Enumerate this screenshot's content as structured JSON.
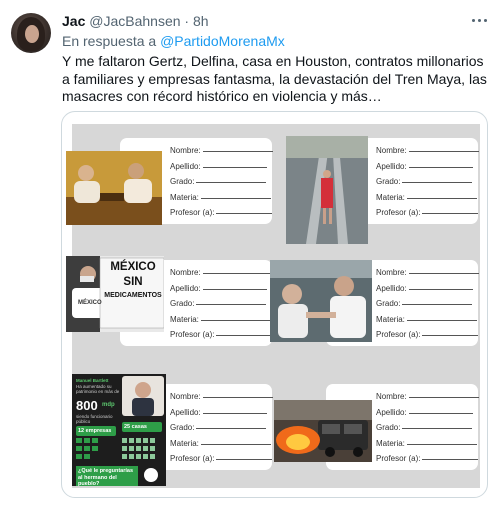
{
  "tweet": {
    "author_name": "Jac",
    "author_handle": "@JacBahnsen",
    "separator": "·",
    "time": "8h",
    "reply_prefix": "En respuesta a",
    "reply_to": "@PartidoMorenaMx",
    "text": "Y me faltaron Gertz, Delfina, casa en Houston, contratos millonarios a familiares y empresas fantasma, la devastación del Tren Maya, las masacres con récord histórico en violencia y más…"
  },
  "media": {
    "form_labels": {
      "nombre": "Nombre:",
      "apellido": "Apellido:",
      "grado": "Grado:",
      "materia": "Materia:",
      "profesor": "Profesor (a):"
    },
    "protest_sign": [
      "MÉXICO",
      "SIN",
      "MEDICAMENTOS"
    ],
    "protest_shirt": "MÉXICO",
    "infographic": {
      "small_title": "Manuel Bartlett",
      "subtitle": "Ha aumentado su patrimonio en más de",
      "amount": "800",
      "unit": "mdp",
      "item1": "siendo funcionario público",
      "companies": "12 empresas",
      "houses": "25 casas",
      "question": "¿Qué le preguntarías al hermano del pueblo?"
    },
    "colors": {
      "card_bg": "#ffffff",
      "grid_bg": "#d7d7d7",
      "infographic_green": "#2e9e48",
      "fire": "#f06a1a"
    }
  },
  "icons": {
    "more": "more-horizontal-icon",
    "avatar": "user-avatar"
  }
}
